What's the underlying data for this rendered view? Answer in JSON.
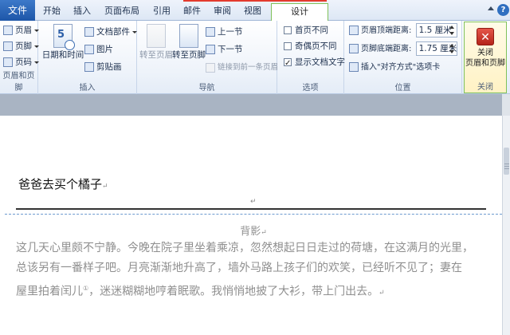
{
  "tabs": [
    {
      "label": "文件"
    },
    {
      "label": "开始"
    },
    {
      "label": "插入"
    },
    {
      "label": "页面布局"
    },
    {
      "label": "引用"
    },
    {
      "label": "邮件"
    },
    {
      "label": "审阅"
    },
    {
      "label": "视图"
    },
    {
      "label": "设计"
    }
  ],
  "ribbon": {
    "header_footer": {
      "header": "页眉",
      "footer": "页脚",
      "page_number": "页码",
      "label": "页眉和页脚"
    },
    "insert": {
      "datetime": "日期和时间",
      "calendar_number": "5",
      "doc_parts": "文档部件",
      "picture": "图片",
      "clipart": "剪贴画",
      "label": "插入"
    },
    "navigation": {
      "goto_header": "转至页眉",
      "goto_footer": "转至页脚",
      "prev_section": "上一节",
      "next_section": "下一节",
      "link_previous": "链接到前一条页眉",
      "label": "导航"
    },
    "options": {
      "first_page": "首页不同",
      "odd_even": "奇偶页不同",
      "show_text": "显示文档文字",
      "label": "选项"
    },
    "position": {
      "header_top": "页眉顶端距离:",
      "header_top_value": "1.5 厘米",
      "footer_bottom": "页脚底端距离:",
      "footer_bottom_value": "1.75 厘米",
      "insert_align_tab": "插入\"对齐方式\"选项卡",
      "label": "位置"
    },
    "close": {
      "line1": "关闭",
      "line2": "页眉和页脚",
      "label": "关闭"
    }
  },
  "document": {
    "header_text": "爸爸去买个橘子",
    "paragraph_mark": "↵",
    "title": "背影",
    "body_lines": [
      "这几天心里颇不宁静。今晚在院子里坐着乘凉，忽然想起日日走过的荷塘，在这满月的光里，",
      "总该另有一番样子吧。月亮渐渐地升高了，墙外马路上孩子们的欢笑，已经听不见了；妻在",
      "屋里拍着闰儿",
      "迷迷糊糊地哼着眠歌。我悄悄地披了大衫，带上门出去。"
    ],
    "footnote_ref": "①"
  },
  "colors": {
    "accent_green": "#7fc15a",
    "file_tab_blue": "#2b67b8",
    "close_red": "#c9342a"
  }
}
